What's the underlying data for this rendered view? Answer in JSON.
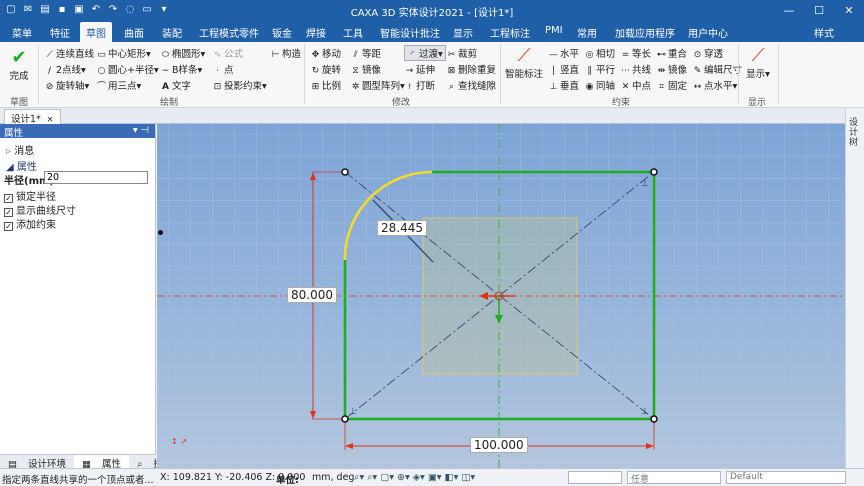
{
  "window": {
    "title": "CAXA 3D 实体设计2021 - [设计1*]"
  },
  "menu": {
    "tabs": [
      "菜单",
      "特征",
      "草图",
      "曲面",
      "装配",
      "工程模式零件",
      "钣金",
      "焊接",
      "工具",
      "智能设计批注",
      "显示",
      "工程标注",
      "PMI",
      "常用",
      "加载应用程序",
      "用户中心"
    ],
    "active": "草图",
    "style_option": "样式"
  },
  "ribbon": {
    "complete": {
      "label": "完成",
      "group": "草图"
    },
    "draw": {
      "group": "绘制",
      "items": [
        "连续直线",
        "中心矩形",
        "椭圆形",
        "公式",
        "构造",
        "2点线",
        "圆心+半径",
        "B样条",
        "点",
        "旋转轴",
        "用三点",
        "文字",
        "投影约束"
      ]
    },
    "modify": {
      "group": "修改",
      "items": [
        "移动",
        "等距",
        "过渡",
        "裁剪",
        "旋转",
        "镜像",
        "延伸",
        "删除重复",
        "比例",
        "圆型阵列",
        "打断",
        "查找缝隙"
      ]
    },
    "constraint": {
      "group": "约束",
      "smart_dim": "智能标注",
      "items": [
        "水平",
        "相切",
        "等长",
        "重合",
        "穿透",
        "竖直",
        "平行",
        "共线",
        "镜像",
        "编辑尺寸",
        "垂直",
        "同轴",
        "中点",
        "固定",
        "点水平"
      ]
    },
    "display": {
      "label": "显示",
      "group": "显示"
    }
  },
  "doc_tab": {
    "label": "设计1*"
  },
  "panel": {
    "title": "属性",
    "sections": [
      "消息",
      "属性"
    ],
    "radius_label": "半径(mm)",
    "radius_value": "20",
    "checks": [
      {
        "label": "锁定半径",
        "checked": true
      },
      {
        "label": "显示曲线尺寸",
        "checked": true
      },
      {
        "label": "添加约束",
        "checked": true
      }
    ],
    "tabs": [
      "设计环境",
      "属性",
      "搜索"
    ]
  },
  "canvas": {
    "dims": {
      "height": "80.000",
      "width": "100.000",
      "diagonal": "28.445"
    }
  },
  "right_strip": {
    "label": "设计树"
  },
  "status": {
    "hint": "指定两条直线共享的一个顶点或者...",
    "coords": "X: 109.821 Y: -20.406 Z: 0.000",
    "unit_label": "单位:",
    "unit_value": "mm, deg",
    "any": "任意",
    "default": "Default"
  },
  "colors": {
    "accent": "#1f5fa8",
    "sketch_green": "#1fae1f",
    "arc_yellow": "#f2dc2a",
    "dim_red": "#e0321e"
  }
}
